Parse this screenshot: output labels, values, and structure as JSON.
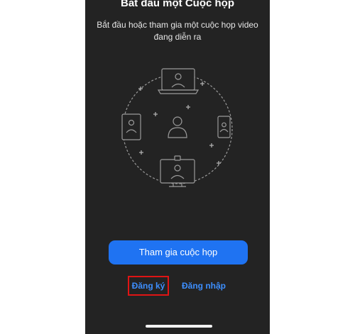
{
  "screen": {
    "title": "Bắt đầu một Cuộc họp",
    "subtitle": "Bắt đầu hoặc tham gia một cuộc họp video đang diễn ra"
  },
  "illustration": {
    "icons": [
      "laptop-icon",
      "tablet-icon",
      "user-icon",
      "phone-icon",
      "desktop-monitor-icon",
      "plus-icon"
    ],
    "line_color": "#9a9a9a"
  },
  "actions": {
    "join_label": "Tham gia cuộc họp",
    "signup_label": "Đăng ký",
    "signin_label": "Đăng nhập"
  },
  "colors": {
    "background": "#232323",
    "accent": "#1f73f2",
    "link": "#3d8fff",
    "highlight_border": "#e01414"
  }
}
